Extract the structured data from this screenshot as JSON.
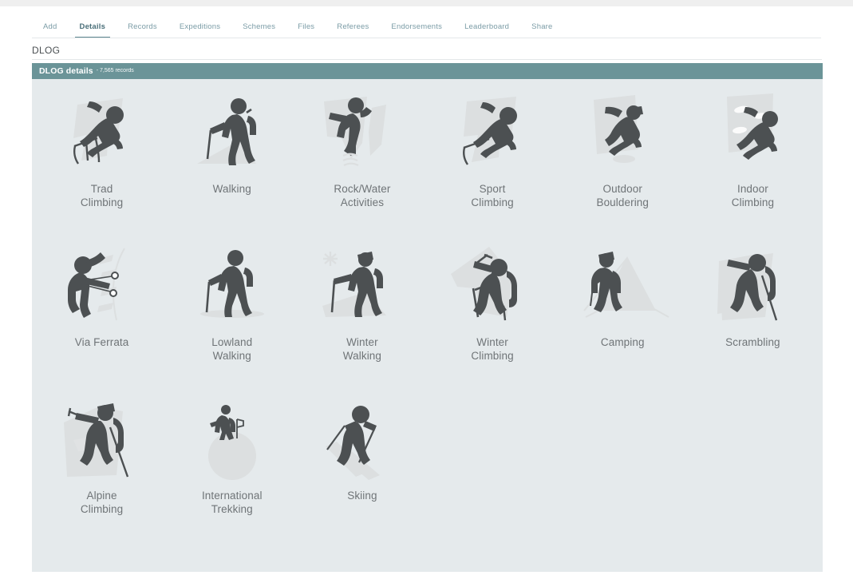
{
  "tabs": [
    {
      "label": "Add",
      "active": false
    },
    {
      "label": "Details",
      "active": true
    },
    {
      "label": "Records",
      "active": false
    },
    {
      "label": "Expeditions",
      "active": false
    },
    {
      "label": "Schemes",
      "active": false
    },
    {
      "label": "Files",
      "active": false
    },
    {
      "label": "Referees",
      "active": false
    },
    {
      "label": "Endorsements",
      "active": false
    },
    {
      "label": "Leaderboard",
      "active": false
    },
    {
      "label": "Share",
      "active": false
    }
  ],
  "page": {
    "title": "DLOG"
  },
  "panel": {
    "heading": "DLOG details",
    "subheading": "- 7,565 records"
  },
  "colors": {
    "header_teal": "#6b9498",
    "panel_bg": "#e5eaec",
    "figure": "#4c5052",
    "terrain": "#dcdfe0",
    "tab_inactive": "#7b9ca6",
    "tab_active": "#4a6f79",
    "label_text": "#6f7477"
  },
  "activities": [
    {
      "label": "Trad\nClimbing",
      "icon": "trad-climbing-icon"
    },
    {
      "label": "Walking",
      "icon": "walking-icon"
    },
    {
      "label": "Rock/Water\nActivities",
      "icon": "rock-water-activities-icon"
    },
    {
      "label": "Sport\nClimbing",
      "icon": "sport-climbing-icon"
    },
    {
      "label": "Outdoor\nBouldering",
      "icon": "outdoor-bouldering-icon"
    },
    {
      "label": "Indoor\nClimbing",
      "icon": "indoor-climbing-icon"
    },
    {
      "label": "Via Ferrata",
      "icon": "via-ferrata-icon"
    },
    {
      "label": "Lowland\nWalking",
      "icon": "lowland-walking-icon"
    },
    {
      "label": "Winter\nWalking",
      "icon": "winter-walking-icon"
    },
    {
      "label": "Winter\nClimbing",
      "icon": "winter-climbing-icon"
    },
    {
      "label": "Camping",
      "icon": "camping-icon"
    },
    {
      "label": "Scrambling",
      "icon": "scrambling-icon"
    },
    {
      "label": "Alpine\nClimbing",
      "icon": "alpine-climbing-icon"
    },
    {
      "label": "International\nTrekking",
      "icon": "international-trekking-icon"
    },
    {
      "label": "Skiing",
      "icon": "skiing-icon"
    }
  ]
}
